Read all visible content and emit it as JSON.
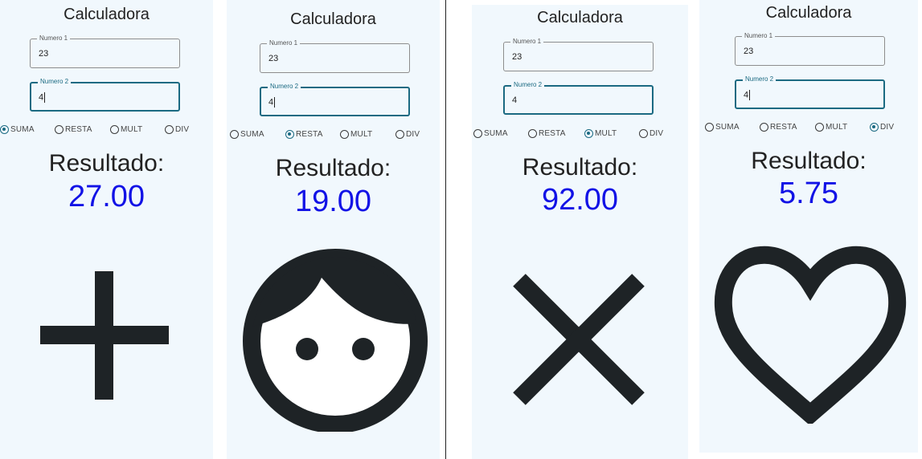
{
  "app_title": "Calculadora",
  "field1_label": "Numero 1",
  "field2_label": "Numero 2",
  "radio_labels": [
    "SUMA",
    "RESTA",
    "MULT",
    "DIV"
  ],
  "result_label": "Resultado:",
  "panels": [
    {
      "numero1": "23",
      "numero2": "4",
      "selected": "SUMA",
      "resultado": "27.00",
      "icon": "plus-icon"
    },
    {
      "numero1": "23",
      "numero2": "4",
      "selected": "RESTA",
      "resultado": "19.00",
      "icon": "face-icon"
    },
    {
      "numero1": "23",
      "numero2": "4",
      "selected": "MULT",
      "resultado": "92.00",
      "icon": "close-icon"
    },
    {
      "numero1": "23",
      "numero2": "4",
      "selected": "DIV",
      "resultado": "5.75",
      "icon": "heart-icon"
    }
  ],
  "colors": {
    "panel_bg": "#f1f8fd",
    "accent": "#1b6a82",
    "result_value": "#1212e6",
    "icon": "#1e2326"
  }
}
